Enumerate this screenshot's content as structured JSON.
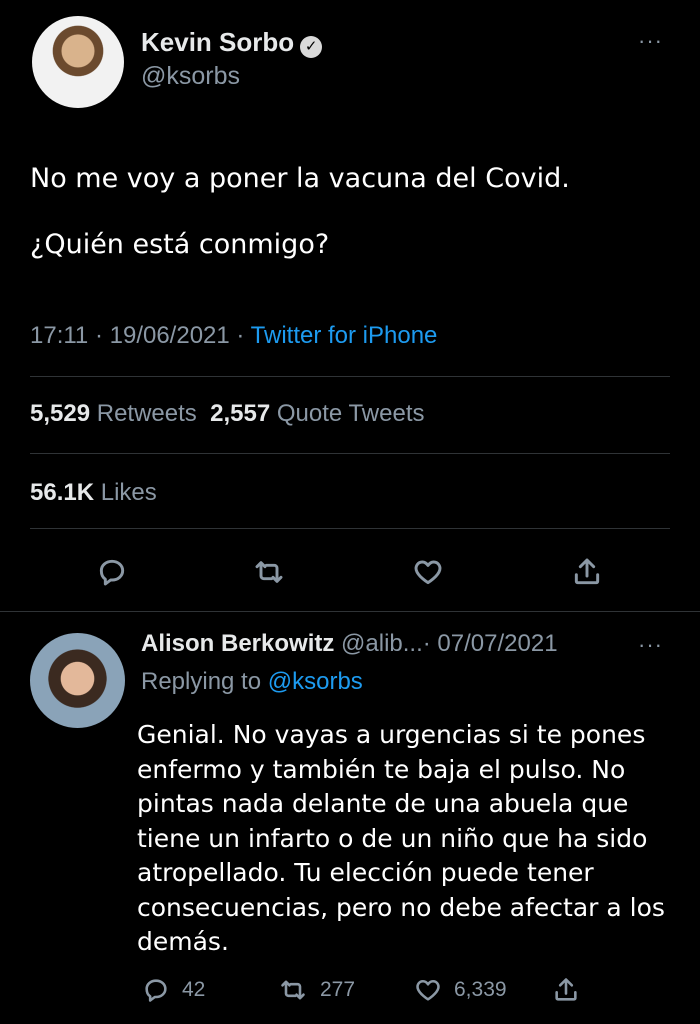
{
  "tweet": {
    "author": {
      "name": "Kevin Sorbo",
      "handle": "@ksorbs"
    },
    "more_label": "···",
    "text_line1": "No me voy a poner la vacuna del Covid.",
    "text_line2": "¿Quién está conmigo?",
    "time": "17:11",
    "date": "19/06/2021",
    "sep": "·",
    "source": "Twitter for iPhone",
    "retweets_count": "5,529",
    "retweets_label": "Retweets",
    "quotes_count": "2,557",
    "quotes_label": "Quote Tweets",
    "likes_count": "56.1K",
    "likes_label": "Likes",
    "actions": [
      "reply-icon",
      "retweet-icon",
      "like-icon",
      "share-icon"
    ]
  },
  "reply": {
    "author": {
      "name": "Alison Berkowitz",
      "handle": "@alib...",
      "date": "· 07/07/2021"
    },
    "more_label": "···",
    "replying_prefix": "Replying to",
    "replying_handle": "@ksorbs",
    "text": "Genial. No vayas a urgencias si te pones enfermo y también te baja el pulso. No pintas nada delante de una abuela que tiene un infarto o de un niño que ha sido atropellado. Tu elección puede tener consecuencias, pero no debe afectar a los demás.",
    "replies": "42",
    "retweets": "277",
    "likes": "6,339"
  },
  "colors": {
    "background": "#000000",
    "text": "#e7e9ea",
    "muted": "#8b98a5",
    "link": "#1d9bf0",
    "divider": "#2f3336"
  }
}
